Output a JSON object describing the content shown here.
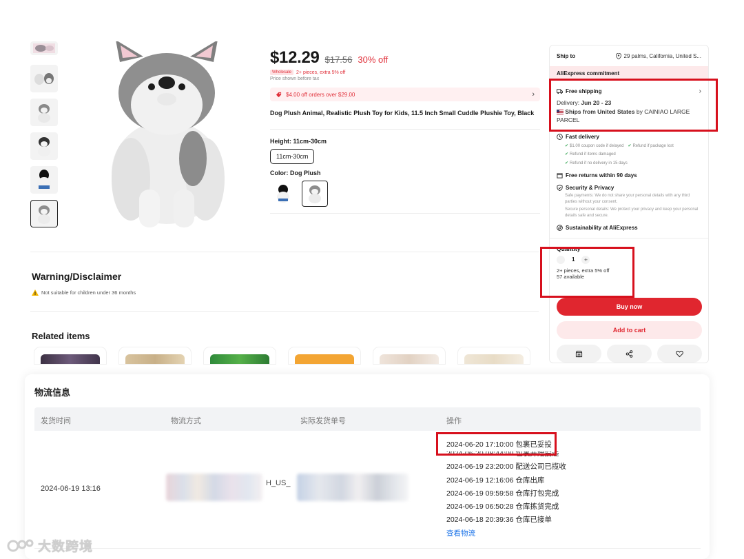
{
  "product": {
    "price": "$12.29",
    "original_price": "$17.56",
    "discount": "30% off",
    "wholesale_tag": "Wholesale",
    "wholesale_note": "2+ pieces, extra 5% off",
    "tax_note": "Price shown before tax",
    "coupon": "$4.00 off orders over $29.00",
    "coupon_arrow": "›",
    "title": "Dog Plush Animal, Realistic Plush Toy for Kids, 11.5 Inch Small Cuddle Plushie Toy, Black",
    "height_label": "Height: 11cm-30cm",
    "height_option": "11cm-30cm",
    "color_label": "Color: Dog Plush"
  },
  "warning": {
    "title": "Warning/Disclaimer",
    "text": "Not suitable for children under 36 months"
  },
  "related": {
    "title": "Related items"
  },
  "panel": {
    "ship_to_label": "Ship to",
    "ship_to_location": "29 palms, California, United S...",
    "commitment": "AliExpress commitment",
    "free_shipping": "Free shipping",
    "free_shipping_arrow": "›",
    "delivery_label": "Delivery:",
    "delivery_dates": "Jun 20 - 23",
    "ships_from_prefix": "Ships from",
    "ships_from_country": "United States",
    "ships_from_by": "by CAINIAO LARGE PARCEL",
    "fast_delivery": "Fast delivery",
    "fast_items": [
      "$1.00 coupon code if delayed",
      "Refund if package lost",
      "Refund if items damaged",
      "Refund if no delivery in 15 days"
    ],
    "free_returns": "Free returns within 90 days",
    "security": "Security & Privacy",
    "security_text_1": "Safe payments: We do not share your personal details with any third parties without your consent.",
    "security_text_2": "Secure personal details: We protect your privacy and keep your personal details safe and secure.",
    "sustainability": "Sustainability at AliExpress",
    "quantity_title": "Quantity",
    "quantity_minus": "-",
    "quantity_value": "1",
    "quantity_plus": "+",
    "quantity_note": "2+ pieces, extra 5% off",
    "available": "57 available",
    "buy_now": "Buy now",
    "add_to_cart": "Add to cart"
  },
  "logistics": {
    "title": "物流信息",
    "columns": [
      "发货时间",
      "物流方式",
      "实际发货单号",
      "操作"
    ],
    "ship_date": "2024-06-19 13:16",
    "method_suffix": "H_US_",
    "events": [
      "2024-06-20 17:10:00 包裹已妥投",
      "2024-06-20 08:44:00 包裹开始投递",
      "2024-06-19 23:20:00 配送公司已揽收",
      "2024-06-19 12:16:06 仓库出库",
      "2024-06-19 09:59:58 仓库打包完成",
      "2024-06-19 06:50:28 仓库拣货完成",
      "2024-06-18 20:39:36 仓库已接单"
    ],
    "track_link": "查看物流"
  },
  "watermark": {
    "text": "大数跨境"
  },
  "colors": {
    "accent_red": "#e0262f",
    "highlight_red": "#d7101d",
    "link_blue": "#1b73e8"
  }
}
